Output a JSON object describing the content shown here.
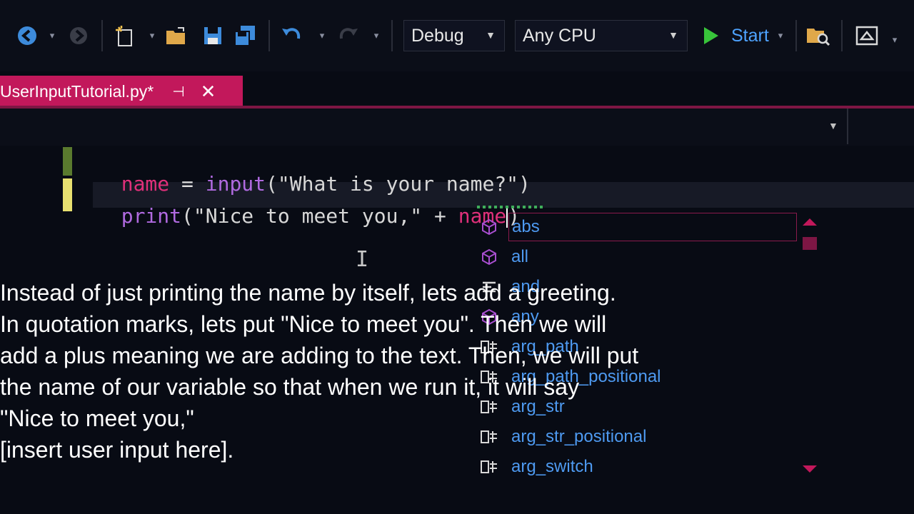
{
  "toolbar": {
    "config_value": "Debug",
    "platform_value": "Any CPU",
    "start_label": "Start",
    "icons": [
      "back-icon",
      "forward-icon",
      "new-project-icon",
      "open-icon",
      "save-icon",
      "save-all-icon",
      "undo-icon",
      "redo-icon",
      "find-in-files-icon",
      "solution-explorer-icon"
    ]
  },
  "tab": {
    "title": "UserInputTutorial.py*",
    "pin_glyph": "⊣",
    "close_glyph": "✕"
  },
  "code": {
    "line1": {
      "var": "name",
      "op": " = ",
      "fn": "input",
      "args": "(\"What is your name?\")"
    },
    "line2": {
      "fn": "print",
      "args": "(\"Nice to meet you,\" + ",
      "var": "name",
      "close": ")"
    }
  },
  "completion": {
    "items": [
      {
        "label": "abs",
        "icon": "cube-icon",
        "selected": true
      },
      {
        "label": "all",
        "icon": "cube-icon"
      },
      {
        "label": "and",
        "icon": "keyword-icon"
      },
      {
        "label": "any",
        "icon": "cube-icon"
      },
      {
        "label": "arg_path",
        "icon": "snippet-icon"
      },
      {
        "label": "arg_path_positional",
        "icon": "snippet-icon"
      },
      {
        "label": "arg_str",
        "icon": "snippet-icon"
      },
      {
        "label": "arg_str_positional",
        "icon": "snippet-icon"
      },
      {
        "label": "arg_switch",
        "icon": "snippet-icon"
      }
    ]
  },
  "caption": {
    "lines": [
      "Instead of just printing the name by itself, lets add a greeting.",
      "In quotation marks, lets put \"Nice to meet you\". Then we will",
      "add a plus meaning we are adding to the text. Then, we will put",
      "the name of our variable so that when we run it, it will say",
      "\"Nice to meet you,\"",
      "[insert user input here]."
    ]
  },
  "colors": {
    "tab_accent": "#c2185b",
    "variable": "#e0307a",
    "function": "#b06ae0",
    "completion_text": "#4e9af1",
    "start_play": "#38c43a"
  }
}
